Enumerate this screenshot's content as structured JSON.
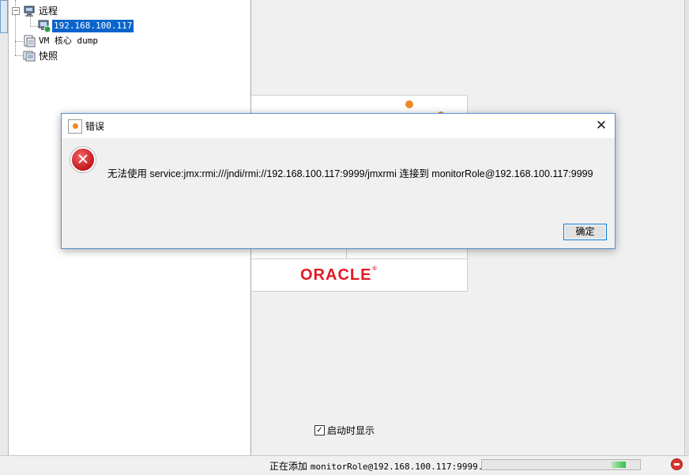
{
  "tree": {
    "items": [
      {
        "label": "远程"
      },
      {
        "label": "192.168.100.117"
      },
      {
        "label": "VM 核心 dump"
      },
      {
        "label": "快照"
      }
    ]
  },
  "start_page": {
    "logo_text": "ORACLE",
    "show_on_startup_label": "启动时显示"
  },
  "status_bar": {
    "text_prefix": "正在添加 ",
    "text_detail": "monitorRole@192.168.100.117:9999...",
    "progress_fraction": 0.9
  },
  "dialog": {
    "title": "错误",
    "message": "无法使用 service:jmx:rmi:///jndi/rmi://192.168.100.117:9999/jmxrmi 连接到 monitorRole@192.168.100.117:9999",
    "close_glyph": "✕",
    "ok_label": "确定",
    "error_glyph": "✕"
  },
  "colors": {
    "selection": "#0a64cc",
    "error": "#c0161a",
    "oracle_red": "#e01b22",
    "focus_border": "#0078d7"
  },
  "icons": [
    "remote-host-icon",
    "host-connected-icon",
    "core-dump-icon",
    "snapshot-icon",
    "error-icon",
    "close-icon",
    "stop-icon",
    "checkbox-checked-icon"
  ]
}
